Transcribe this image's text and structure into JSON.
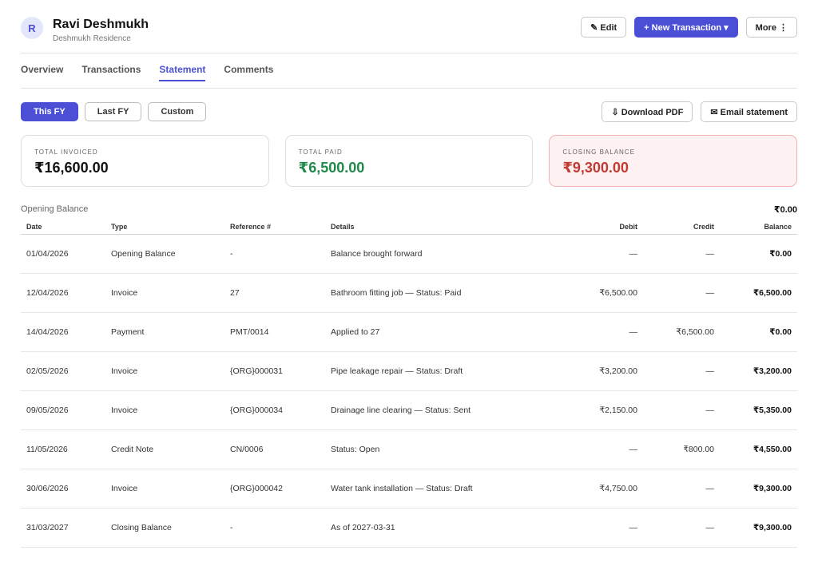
{
  "customer": {
    "initial": "R",
    "name": "Ravi Deshmukh",
    "subtitle": "Deshmukh Residence"
  },
  "header_actions": {
    "edit": "✎ Edit",
    "new_transaction": "+ New Transaction ▾",
    "more": "More ⋮"
  },
  "tabs": [
    {
      "label": "Overview",
      "active": false
    },
    {
      "label": "Transactions",
      "active": false
    },
    {
      "label": "Statement",
      "active": true
    },
    {
      "label": "Comments",
      "active": false
    }
  ],
  "period_filters": [
    {
      "label": "This FY",
      "active": true
    },
    {
      "label": "Last FY",
      "active": false
    },
    {
      "label": "Custom",
      "active": false
    }
  ],
  "export": {
    "download_pdf": "⇩ Download PDF",
    "email_statement": "✉ Email statement"
  },
  "summary": {
    "total_invoiced": {
      "label": "TOTAL INVOICED",
      "value": "₹16,600.00"
    },
    "total_paid": {
      "label": "TOTAL PAID",
      "value": "₹6,500.00"
    },
    "closing_balance": {
      "label": "CLOSING BALANCE",
      "value": "₹9,300.00"
    }
  },
  "opening_balance": {
    "label": "Opening Balance",
    "amount": "₹0.00"
  },
  "table": {
    "columns": [
      "Date",
      "Type",
      "Reference #",
      "Details",
      "Debit",
      "Credit",
      "Balance"
    ],
    "rows": [
      {
        "date": "01/04/2026",
        "date_link": false,
        "type": "Opening Balance",
        "ref": "-",
        "ref_link": false,
        "details": "Balance brought forward",
        "debit": "—",
        "credit": "—",
        "balance": "₹0.00"
      },
      {
        "date": "12/04/2026",
        "date_link": true,
        "type": "Invoice",
        "ref": "27",
        "ref_link": true,
        "details": "Bathroom fitting job — Status: Paid",
        "debit": "₹6,500.00",
        "credit": "—",
        "balance": "₹6,500.00"
      },
      {
        "date": "14/04/2026",
        "date_link": true,
        "type": "Payment",
        "ref": "PMT/0014",
        "ref_link": true,
        "details": "Applied to 27",
        "debit": "—",
        "credit": "₹6,500.00",
        "balance": "₹0.00"
      },
      {
        "date": "02/05/2026",
        "date_link": true,
        "type": "Invoice",
        "ref": "{ORG}000031",
        "ref_link": true,
        "details": "Pipe leakage repair — Status: Draft",
        "debit": "₹3,200.00",
        "credit": "—",
        "balance": "₹3,200.00"
      },
      {
        "date": "09/05/2026",
        "date_link": true,
        "type": "Invoice",
        "ref": "{ORG}000034",
        "ref_link": true,
        "details": "Drainage line clearing — Status: Sent",
        "debit": "₹2,150.00",
        "credit": "—",
        "balance": "₹5,350.00"
      },
      {
        "date": "11/05/2026",
        "date_link": true,
        "type": "Credit Note",
        "ref": "CN/0006",
        "ref_link": true,
        "details": "Status: Open",
        "debit": "—",
        "credit": "₹800.00",
        "balance": "₹4,550.00"
      },
      {
        "date": "30/06/2026",
        "date_link": true,
        "type": "Invoice",
        "ref": "{ORG}000042",
        "ref_link": true,
        "details": "Water tank installation — Status: Draft",
        "debit": "₹4,750.00",
        "credit": "—",
        "balance": "₹9,300.00"
      },
      {
        "date": "31/03/2027",
        "date_link": false,
        "type": "Closing Balance",
        "ref": "-",
        "ref_link": false,
        "details": "As of 2027-03-31",
        "debit": "—",
        "credit": "—",
        "balance": "₹9,300.00"
      }
    ]
  },
  "colors": {
    "accent": "#4a4fd6",
    "paid_green": "#1f8a4a",
    "closing_red": "#c23b32",
    "alert_bg": "#fdf1f1"
  }
}
